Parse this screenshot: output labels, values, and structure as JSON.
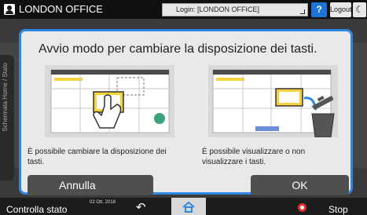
{
  "topbar": {
    "office": "LONDON OFFICE",
    "login": "Login: [LONDON OFFICE]",
    "help_label": "?",
    "logout_label": "Logout",
    "moon_label": "☾"
  },
  "background": {
    "side_tab_label": "Schermata Home / Stato"
  },
  "dialog": {
    "title": "Avvio modo per cambiare la disposizione dei tasti.",
    "left_desc": "È possibile cambiare la disposizione dei tasti.",
    "right_desc": "È possibile visualizzare o non visualizzare i tasti.",
    "cancel_label": "Annulla",
    "ok_label": "OK"
  },
  "bottombar": {
    "status_label": "Controlla stato",
    "date": "02 Ott. 2018",
    "stop_label": "Stop"
  },
  "colors": {
    "accent": "#2d86e0",
    "button_dark": "#4f4f4f",
    "highlight_yellow": "#f5d33a",
    "green_dot": "#3aa37a"
  }
}
